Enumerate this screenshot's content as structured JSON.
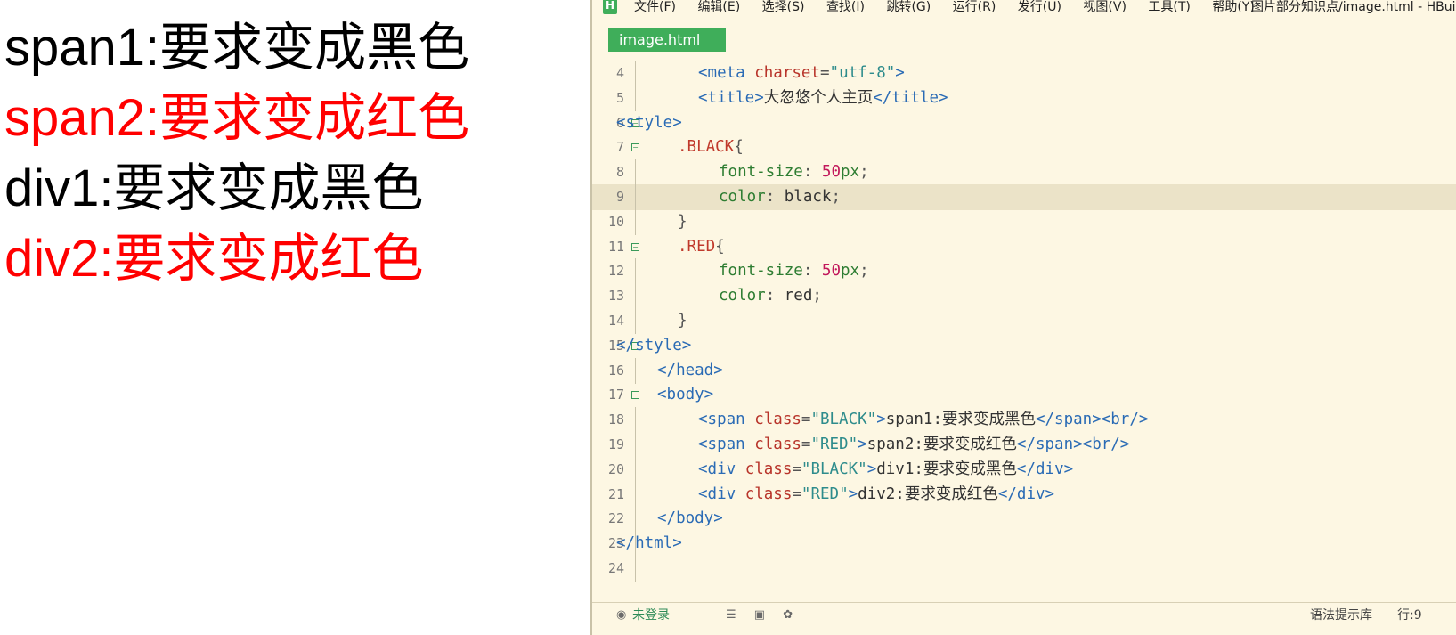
{
  "preview": {
    "lines": [
      {
        "text": "span1:要求变成黑色",
        "color": "#000000"
      },
      {
        "text": "span2:要求变成红色",
        "color": "#ff0000"
      },
      {
        "text": "div1:要求变成黑色",
        "color": "#000000"
      },
      {
        "text": "div2:要求变成红色",
        "color": "#ff0000"
      }
    ]
  },
  "editor": {
    "app_logo": "H",
    "menu": [
      "文件(F)",
      "编辑(E)",
      "选择(S)",
      "查找(I)",
      "跳转(G)",
      "运行(R)",
      "发行(U)",
      "视图(V)",
      "工具(T)",
      "帮助(Y)"
    ],
    "window_title": "图片部分知识点/image.html - HBuilder X",
    "tab": "image.html",
    "code_lines": [
      {
        "n": "4",
        "indent": 4,
        "fold": false,
        "tokens": [
          [
            "tag",
            "<meta "
          ],
          [
            "attr",
            "charset"
          ],
          [
            "punc",
            "="
          ],
          [
            "str",
            "\"utf-8\""
          ],
          [
            "tag",
            ">"
          ]
        ]
      },
      {
        "n": "5",
        "indent": 4,
        "fold": false,
        "tokens": [
          [
            "tag",
            "<title>"
          ],
          [
            "plain",
            "大忽悠个人主页"
          ],
          [
            "tag",
            "</title>"
          ]
        ]
      },
      {
        "n": "6",
        "indent": 0,
        "fold": true,
        "tokens": [
          [
            "tag",
            "<style>"
          ]
        ]
      },
      {
        "n": "7",
        "indent": 3,
        "fold": true,
        "tokens": [
          [
            "sel",
            ".BLACK"
          ],
          [
            "punc",
            "{"
          ]
        ]
      },
      {
        "n": "8",
        "indent": 5,
        "fold": false,
        "tokens": [
          [
            "prop",
            "font-size"
          ],
          [
            "punc",
            ": "
          ],
          [
            "num",
            "50"
          ],
          [
            "prop",
            "px"
          ],
          [
            "punc",
            ";"
          ]
        ]
      },
      {
        "n": "9",
        "indent": 5,
        "fold": false,
        "highlight": true,
        "tokens": [
          [
            "prop",
            "color"
          ],
          [
            "punc",
            ": "
          ],
          [
            "plain",
            "black"
          ],
          [
            "punc",
            ";"
          ]
        ]
      },
      {
        "n": "10",
        "indent": 3,
        "fold": false,
        "tokens": [
          [
            "punc",
            "}"
          ]
        ]
      },
      {
        "n": "11",
        "indent": 3,
        "fold": true,
        "tokens": [
          [
            "sel",
            ".RED"
          ],
          [
            "punc",
            "{"
          ]
        ]
      },
      {
        "n": "12",
        "indent": 5,
        "fold": false,
        "tokens": [
          [
            "prop",
            "font-size"
          ],
          [
            "punc",
            ": "
          ],
          [
            "num",
            "50"
          ],
          [
            "prop",
            "px"
          ],
          [
            "punc",
            ";"
          ]
        ]
      },
      {
        "n": "13",
        "indent": 5,
        "fold": false,
        "tokens": [
          [
            "prop",
            "color"
          ],
          [
            "punc",
            ": "
          ],
          [
            "plain",
            "red"
          ],
          [
            "punc",
            ";"
          ]
        ]
      },
      {
        "n": "14",
        "indent": 3,
        "fold": false,
        "tokens": [
          [
            "punc",
            "}"
          ]
        ]
      },
      {
        "n": "15",
        "indent": 0,
        "fold": true,
        "tokens": [
          [
            "tag",
            "</style>"
          ]
        ]
      },
      {
        "n": "16",
        "indent": 2,
        "fold": false,
        "tokens": [
          [
            "tag",
            "</head>"
          ]
        ]
      },
      {
        "n": "17",
        "indent": 2,
        "fold": true,
        "tokens": [
          [
            "tag",
            "<body>"
          ]
        ]
      },
      {
        "n": "18",
        "indent": 4,
        "fold": false,
        "tokens": [
          [
            "tag",
            "<span "
          ],
          [
            "attr",
            "class"
          ],
          [
            "punc",
            "="
          ],
          [
            "str",
            "\"BLACK\""
          ],
          [
            "tag",
            ">"
          ],
          [
            "plain",
            "span1:要求变成黑色"
          ],
          [
            "tag",
            "</span><br/>"
          ]
        ]
      },
      {
        "n": "19",
        "indent": 4,
        "fold": false,
        "tokens": [
          [
            "tag",
            "<span "
          ],
          [
            "attr",
            "class"
          ],
          [
            "punc",
            "="
          ],
          [
            "str",
            "\"RED\""
          ],
          [
            "tag",
            ">"
          ],
          [
            "plain",
            "span2:要求变成红色"
          ],
          [
            "tag",
            "</span><br/>"
          ]
        ]
      },
      {
        "n": "20",
        "indent": 4,
        "fold": false,
        "tokens": [
          [
            "tag",
            "<div "
          ],
          [
            "attr",
            "class"
          ],
          [
            "punc",
            "="
          ],
          [
            "str",
            "\"BLACK\""
          ],
          [
            "tag",
            ">"
          ],
          [
            "plain",
            "div1:要求变成黑色"
          ],
          [
            "tag",
            "</div>"
          ]
        ]
      },
      {
        "n": "21",
        "indent": 4,
        "fold": false,
        "tokens": [
          [
            "tag",
            "<div "
          ],
          [
            "attr",
            "class"
          ],
          [
            "punc",
            "="
          ],
          [
            "str",
            "\"RED\""
          ],
          [
            "tag",
            ">"
          ],
          [
            "plain",
            "div2:要求变成红色"
          ],
          [
            "tag",
            "</div>"
          ]
        ]
      },
      {
        "n": "22",
        "indent": 2,
        "fold": false,
        "tokens": [
          [
            "tag",
            "</body>"
          ]
        ]
      },
      {
        "n": "23",
        "indent": 0,
        "fold": false,
        "tokens": [
          [
            "tag",
            "</html>"
          ]
        ]
      },
      {
        "n": "24",
        "indent": 0,
        "fold": false,
        "tokens": []
      }
    ]
  },
  "status": {
    "user_icon": "user-icon",
    "login": "未登录",
    "syntax_lib": "语法提示库",
    "row_col": "行:9"
  }
}
